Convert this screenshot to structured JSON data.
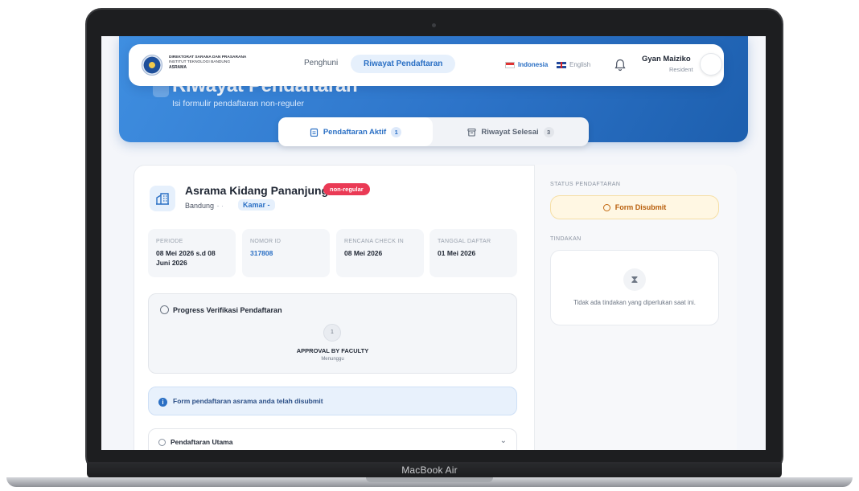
{
  "device": {
    "label": "MacBook Air"
  },
  "header": {
    "org_line1": "DIREKTORAT SARANA DAN PRASARANA",
    "org_line2": "INSTITUT TEKNOLOGI BANDUNG",
    "org_line3": "ASRAMA",
    "nav": [
      {
        "label": "Penghuni",
        "active": false
      },
      {
        "label": "Riwayat Pendaftaran",
        "active": true
      }
    ],
    "languages": [
      {
        "label": "Indonesia",
        "active": true
      },
      {
        "label": "English",
        "active": false
      }
    ],
    "user": {
      "name": "Gyan Maiziko",
      "role": "Resident"
    }
  },
  "banner": {
    "title": "Riwayat Pendaftaran",
    "subtitle": "Isi formulir pendaftaran non-reguler"
  },
  "tabs": [
    {
      "label": "Pendaftaran Aktif",
      "count": "1",
      "active": true
    },
    {
      "label": "Riwayat Selesai",
      "count": "3",
      "active": false
    }
  ],
  "registration": {
    "building": "Asrama Kidang Pananjung",
    "type_badge": "non-regular",
    "city": "Bandung",
    "separator": "· - ·",
    "room": "Kamar -",
    "info": [
      {
        "label": "PERIODE",
        "value": "08 Mei 2026 s.d 08 Juni 2026"
      },
      {
        "label": "NOMOR ID",
        "value": "317808"
      },
      {
        "label": "RENCANA CHECK IN",
        "value": "08 Mei 2026"
      },
      {
        "label": "TANGGAL DAFTAR",
        "value": "01 Mei 2026"
      }
    ],
    "progress": {
      "title": "Progress Verifikasi Pendaftaran",
      "step_number": "1",
      "step_label": "APPROVAL BY FACULTY",
      "step_status": "Menunggu"
    },
    "alert": "Form pendaftaran asrama anda telah disubmit",
    "accordion": "Pendaftaran Utama"
  },
  "sidebar": {
    "status_label": "STATUS PENDAFTARAN",
    "status_value": "Form Disubmit",
    "action_label": "TINDAKAN",
    "no_action": "Tidak ada tindakan yang diperlukan saat ini."
  },
  "colors": {
    "primary": "#2a6fc4",
    "banner": "#3f8ee0",
    "badge": "#ea3a55",
    "status": "#b85e0b"
  }
}
